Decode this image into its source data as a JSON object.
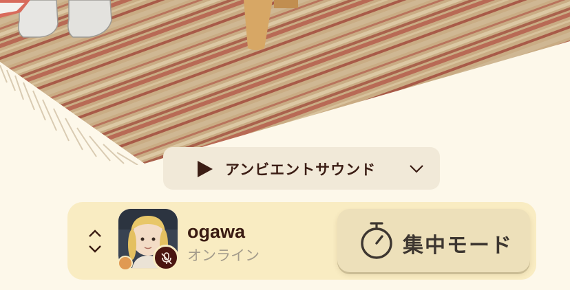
{
  "ambient": {
    "label": "アンビエントサウンド",
    "play_icon": "play-icon",
    "dropdown_icon": "chevron-down-icon"
  },
  "user": {
    "name": "ogawa",
    "status": "オンライン",
    "avatar_icon": "avatar",
    "mic_icon": "mic-off-icon",
    "status_color": "#e09a52"
  },
  "focus_mode": {
    "label": "集中モード",
    "icon": "stopwatch-icon"
  },
  "colors": {
    "background": "#fdf8ea",
    "bar": "#f9ecc2",
    "accent_dark": "#3b1d14",
    "button": "#ede0ba"
  }
}
